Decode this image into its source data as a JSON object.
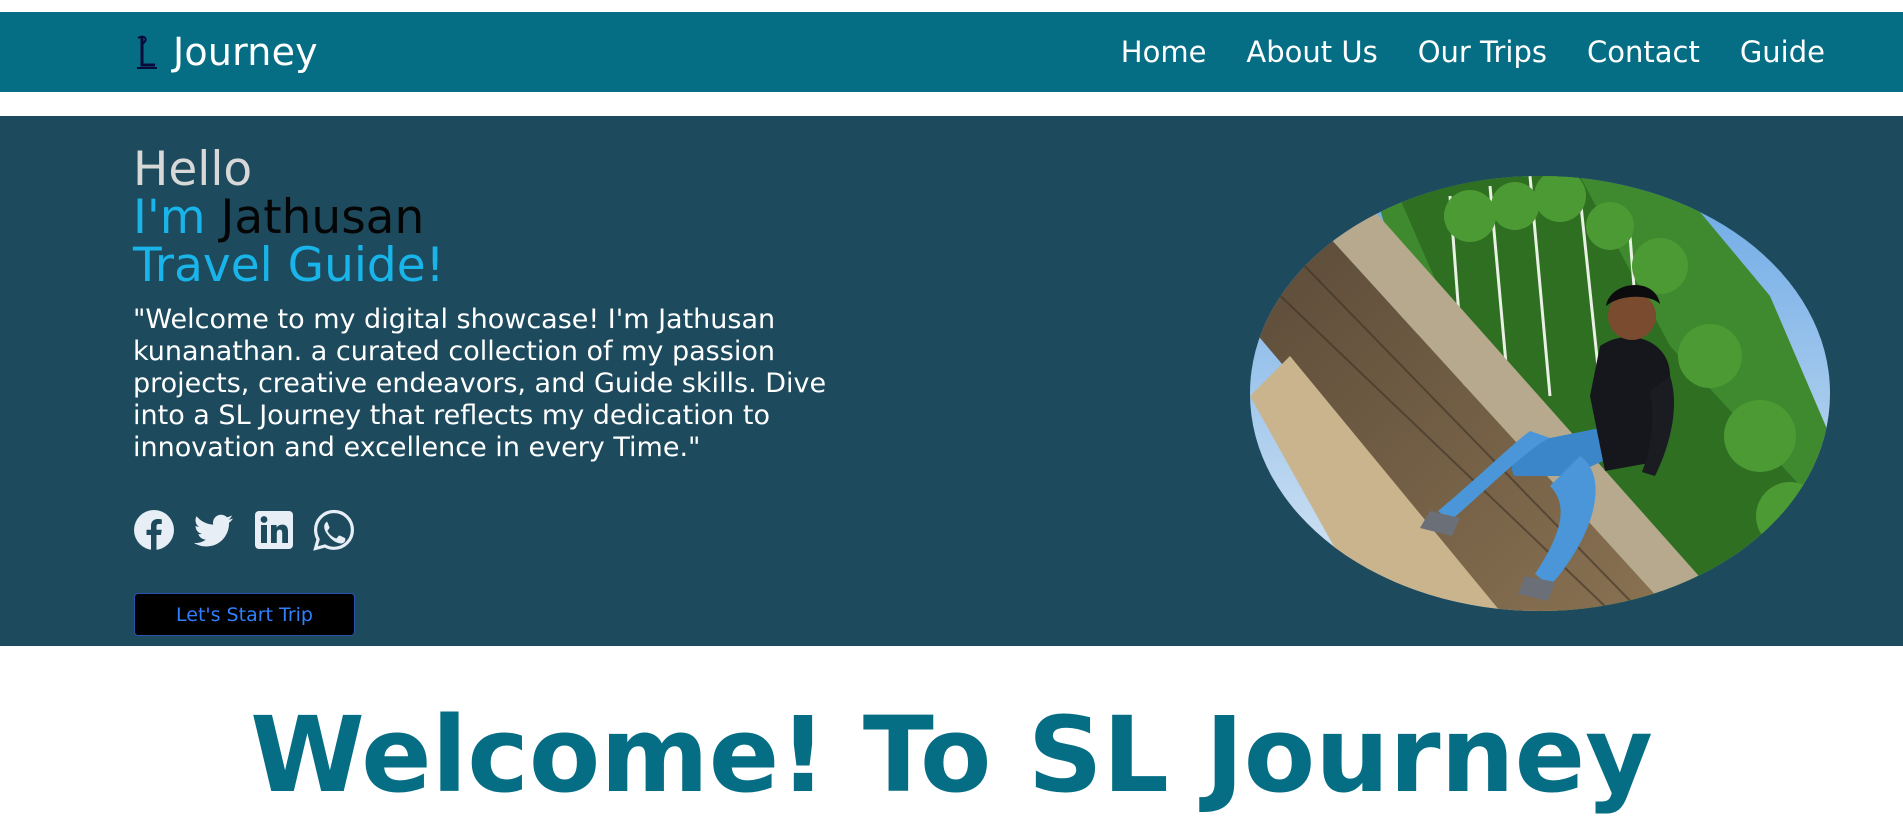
{
  "nav": {
    "brand_name": "Journey",
    "brand_icon": "sl-logo-icon",
    "links": [
      "Home",
      "About Us",
      "Our Trips",
      "Contact",
      "Guide"
    ]
  },
  "hero": {
    "greeting": "Hello",
    "im": "I'm",
    "name": "Jathusan",
    "role": "Travel Guide!",
    "intro": "\"Welcome to my digital showcase! I'm Jathusan kunanathan. a curated collection of my passion projects, creative endeavors, and Guide skills. Dive into a SL Journey that reflects my dedication to innovation and excellence in every Time.\"",
    "socials": [
      "facebook-icon",
      "twitter-icon",
      "linkedin-icon",
      "whatsapp-icon"
    ],
    "cta_label": "Let's Start Trip",
    "photo": "profile-photo"
  },
  "welcome": {
    "heading": "Welcome! To SL Journey"
  },
  "colors": {
    "nav_bg": "#066e84",
    "hero_bg": "#1d4b5d",
    "accent": "#19b4ea",
    "heading": "#066e84"
  }
}
